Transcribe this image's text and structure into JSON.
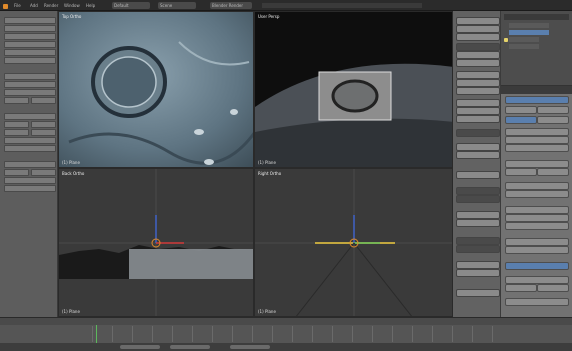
{
  "colors": {
    "background": "#6b6b6b",
    "header": "#2b2b2b",
    "selection_blue": "#5a7fae",
    "axis_red": "#d23b3b",
    "axis_green": "#5cb85c",
    "axis_blue": "#3f62c8",
    "cursor_orange": "#e08a2a"
  },
  "icons": [
    "blender-logo-icon",
    "3d-cursor-icon",
    "axis-widget-icon",
    "lamp-icon"
  ],
  "header": {
    "menus": [
      "File",
      "Add",
      "Render",
      "Window",
      "Help"
    ],
    "layout": "Default",
    "scene": "Scene",
    "engine": "Blender Render"
  },
  "viewports": [
    {
      "title": "Top Ortho",
      "footer": "(1) Plane"
    },
    {
      "title": "User Persp",
      "footer": "(1) Plane"
    },
    {
      "title": "Back Ortho",
      "footer": "(1) Plane"
    },
    {
      "title": "Right Ortho",
      "footer": "(1) Plane"
    }
  ]
}
